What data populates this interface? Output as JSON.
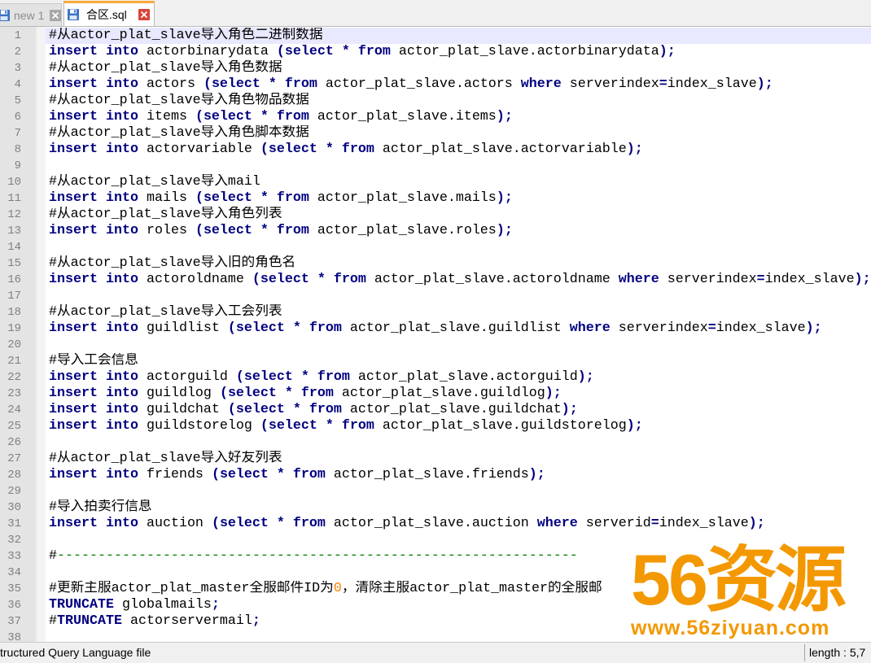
{
  "tabs": [
    {
      "label": "new 1",
      "active": false,
      "icon": "floppy-disk-icon",
      "close_icon": "close-icon"
    },
    {
      "label": "合区.sql",
      "active": true,
      "icon": "floppy-disk-icon",
      "close_icon": "close-icon"
    }
  ],
  "editor": {
    "current_line": 1,
    "line_numbers": [
      1,
      2,
      3,
      4,
      5,
      6,
      7,
      8,
      9,
      10,
      11,
      12,
      13,
      14,
      15,
      16,
      17,
      18,
      19,
      20,
      21,
      22,
      23,
      24,
      25,
      26,
      27,
      28,
      29,
      30,
      31,
      32,
      33,
      34,
      35,
      36,
      37,
      38
    ],
    "lines": [
      "#从actor_plat_slave导入角色二进制数据",
      "insert into actorbinarydata (select * from actor_plat_slave.actorbinarydata);",
      "#从actor_plat_slave导入角色数据",
      "insert into actors (select * from actor_plat_slave.actors where serverindex=index_slave);",
      "#从actor_plat_slave导入角色物品数据",
      "insert into items (select * from actor_plat_slave.items);",
      "#从actor_plat_slave导入角色脚本数据",
      "insert into actorvariable (select * from actor_plat_slave.actorvariable);",
      "",
      "#从actor_plat_slave导入mail",
      "insert into mails (select * from actor_plat_slave.mails);",
      "#从actor_plat_slave导入角色列表",
      "insert into roles (select * from actor_plat_slave.roles);",
      "",
      "#从actor_plat_slave导入旧的角色名",
      "insert into actoroldname (select * from actor_plat_slave.actoroldname where serverindex=index_slave);",
      "",
      "#从actor_plat_slave导入工会列表",
      "insert into guildlist (select * from actor_plat_slave.guildlist where serverindex=index_slave);",
      "",
      "#导入工会信息",
      "insert into actorguild (select * from actor_plat_slave.actorguild);",
      "insert into guildlog (select * from actor_plat_slave.guildlog);",
      "insert into guildchat (select * from actor_plat_slave.guildchat);",
      "insert into guildstorelog (select * from actor_plat_slave.guildstorelog);",
      "",
      "#从actor_plat_slave导入好友列表",
      "insert into friends (select * from actor_plat_slave.friends);",
      "",
      "#导入拍卖行信息",
      "insert into auction (select * from actor_plat_slave.auction where serverid=index_slave);",
      "",
      "#----------------------------------------------------------------",
      "",
      "#更新主服actor_plat_master全服邮件ID为0，清除主服actor_plat_master的全服邮",
      "TRUNCATE globalmails;",
      "#TRUNCATE actorservermail;",
      ""
    ]
  },
  "status_bar": {
    "file_type": "tructured Query Language file",
    "length": "length : 5,7"
  },
  "watermark": {
    "logo": "56资源",
    "url": "www.56ziyuan.com"
  },
  "colors": {
    "keyword": "#000080",
    "number": "#FF8000",
    "comment": "#008000",
    "line_number": "#808080",
    "current_line": "#E8E8FF",
    "tab_accent": "#FAAA3C",
    "close_active": "#D9453B",
    "close_inactive": "#A8A8A8",
    "watermark": "#F39800"
  }
}
